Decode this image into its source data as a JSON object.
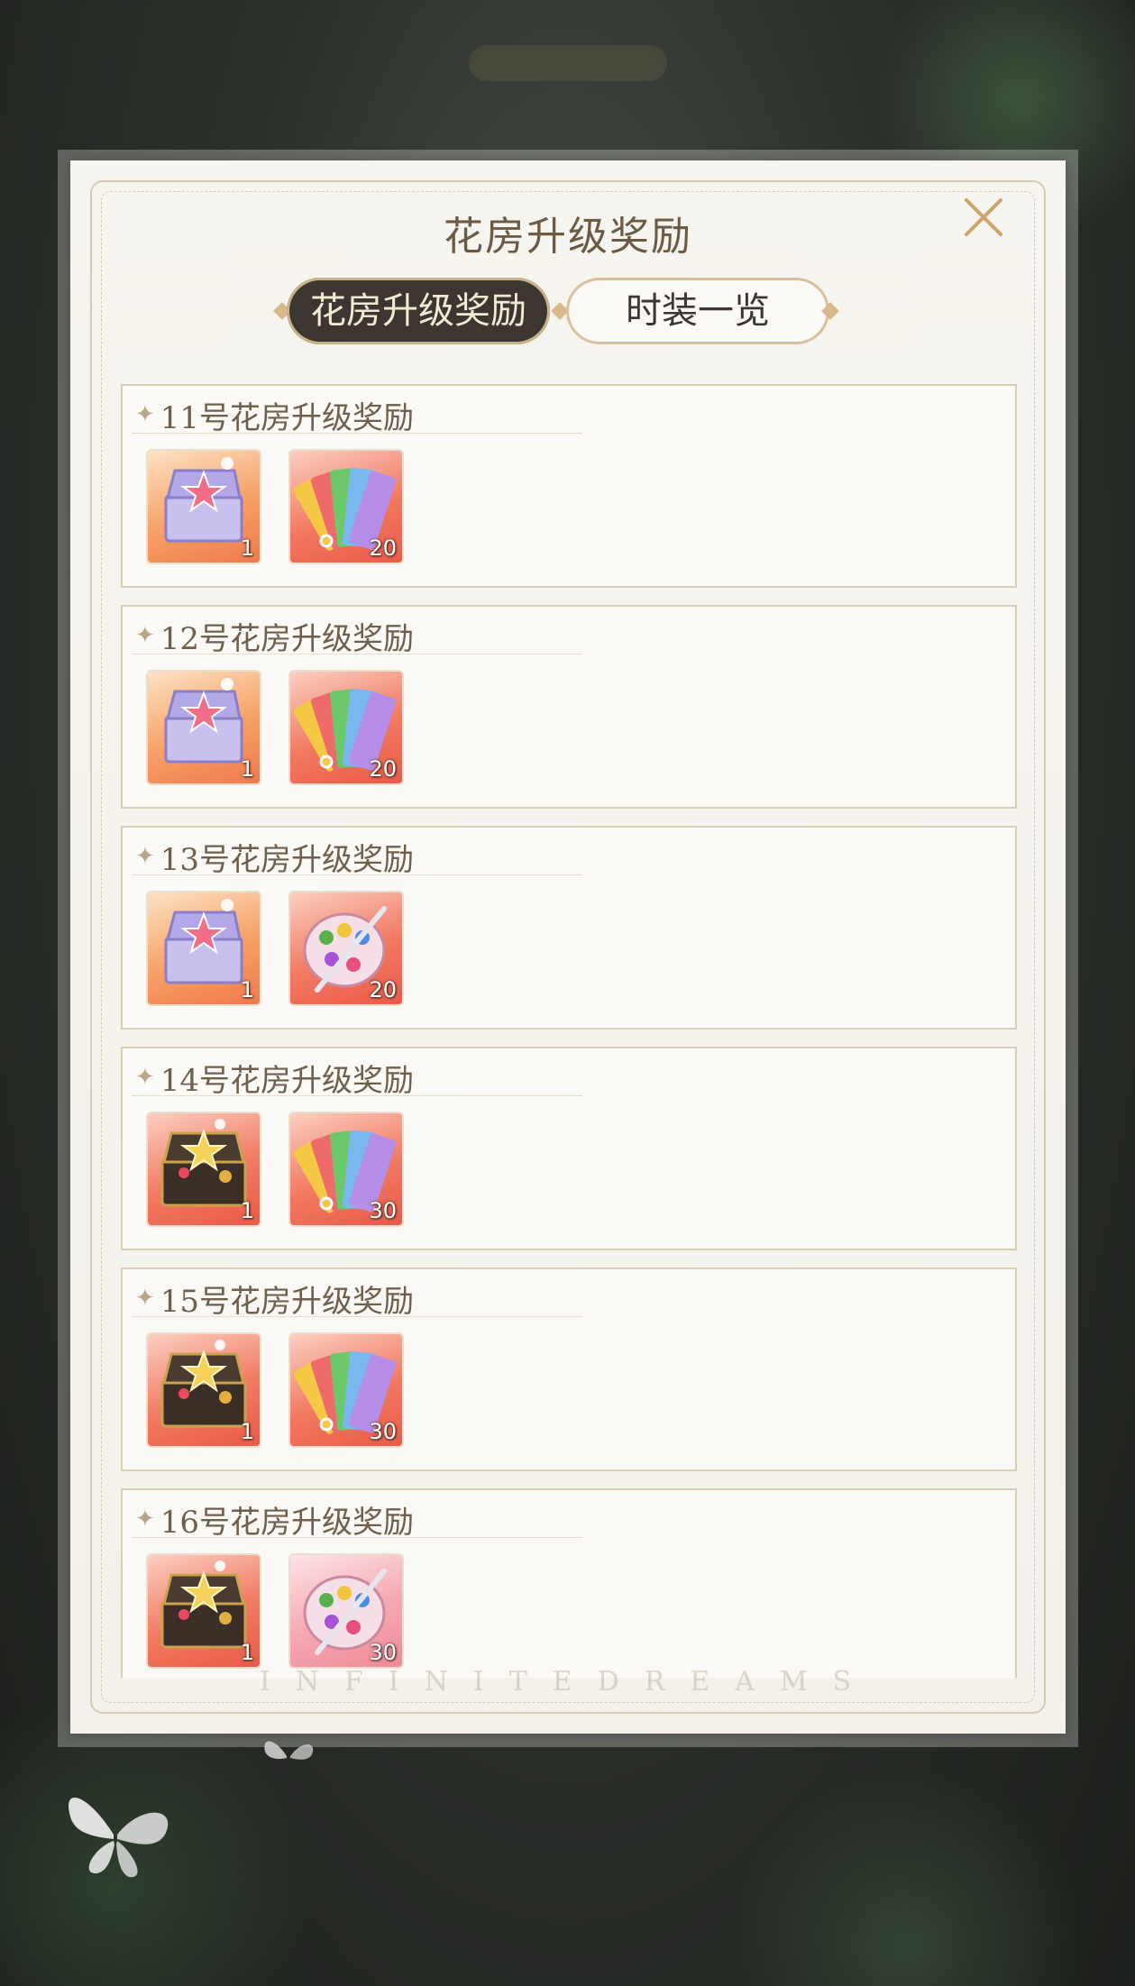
{
  "dialog": {
    "title": "花房升级奖励",
    "close_icon": "close-icon",
    "watermark": "INFINITEDREAMS"
  },
  "tabs": [
    {
      "label": "花房升级奖励",
      "active": true
    },
    {
      "label": "时装一览",
      "active": false
    }
  ],
  "rewards": [
    {
      "title": "11号花房升级奖励",
      "items": [
        {
          "icon": "purple-star-chest-icon",
          "qty": "1",
          "bg": "orange"
        },
        {
          "icon": "color-ticket-fan-icon",
          "qty": "20",
          "bg": "red"
        }
      ]
    },
    {
      "title": "12号花房升级奖励",
      "items": [
        {
          "icon": "purple-star-chest-icon",
          "qty": "1",
          "bg": "orange"
        },
        {
          "icon": "color-ticket-fan-icon",
          "qty": "20",
          "bg": "red"
        }
      ]
    },
    {
      "title": "13号花房升级奖励",
      "items": [
        {
          "icon": "purple-star-chest-icon",
          "qty": "1",
          "bg": "orange"
        },
        {
          "icon": "paint-palette-icon",
          "qty": "20",
          "bg": "red"
        }
      ]
    },
    {
      "title": "14号花房升级奖励",
      "items": [
        {
          "icon": "black-gold-chest-icon",
          "qty": "1",
          "bg": "red"
        },
        {
          "icon": "color-ticket-fan-icon",
          "qty": "30",
          "bg": "red"
        }
      ]
    },
    {
      "title": "15号花房升级奖励",
      "items": [
        {
          "icon": "black-gold-chest-icon",
          "qty": "1",
          "bg": "red"
        },
        {
          "icon": "color-ticket-fan-icon",
          "qty": "30",
          "bg": "red"
        }
      ]
    },
    {
      "title": "16号花房升级奖励",
      "items": [
        {
          "icon": "black-gold-chest-icon",
          "qty": "1",
          "bg": "red"
        },
        {
          "icon": "paint-palette-icon",
          "qty": "30",
          "bg": "pink"
        }
      ]
    }
  ]
}
